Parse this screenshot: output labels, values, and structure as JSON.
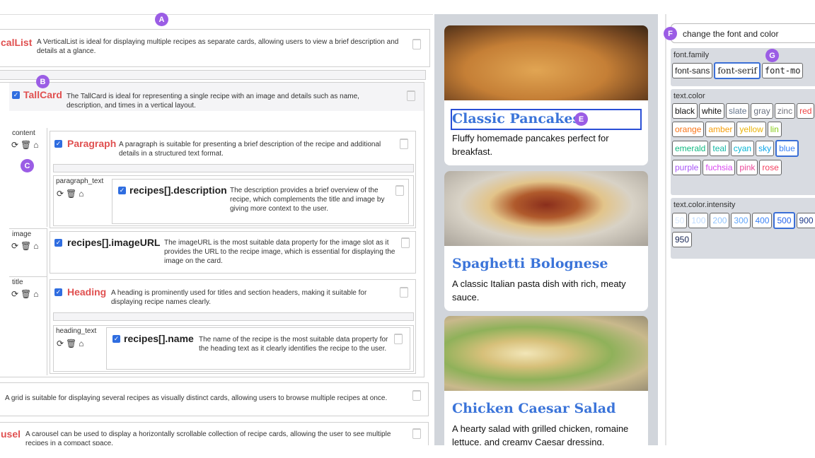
{
  "annotations": {
    "a": "A",
    "b": "B",
    "c": "C",
    "e": "E",
    "f": "F",
    "g": "G"
  },
  "left": {
    "vertical_list": {
      "title": "calList",
      "desc": "A VerticalList is ideal for displaying multiple recipes as separate cards, allowing users to view a brief description and details at a glance."
    },
    "tallcard": {
      "title": "TallCard",
      "desc": "The TallCard is ideal for representing a single recipe with an image and details such as name, description, and times in a vertical layout."
    },
    "slot_content": "content",
    "paragraph": {
      "title": "Paragraph",
      "desc": "A paragraph is suitable for presenting a brief description of the recipe and additional details in a structured text format."
    },
    "slot_paragraph_text": "paragraph_text",
    "desc_prop": {
      "title": "recipes[].description",
      "desc": "The description provides a brief overview of the recipe, which complements the title and image by giving more context to the user."
    },
    "slot_image": "image",
    "image_prop": {
      "title": "recipes[].imageURL",
      "desc": "The imageURL is the most suitable data property for the image slot as it provides the URL to the recipe image, which is essential for displaying the image on the card."
    },
    "slot_title": "title",
    "heading": {
      "title": "Heading",
      "desc": "A heading is prominently used for titles and section headers, making it suitable for displaying recipe names clearly."
    },
    "slot_heading_text": "heading_text",
    "name_prop": {
      "title": "recipes[].name",
      "desc": "The name of the recipe is the most suitable data property for the heading text as it clearly identifies the recipe to the user."
    },
    "grid": {
      "desc": "A grid is suitable for displaying several recipes as visually distinct cards, allowing users to browse multiple recipes at once."
    },
    "carousel": {
      "title": "usel",
      "desc": "A carousel can be used to display a horizontally scrollable collection of recipe cards, allowing the user to see multiple recipes in a compact space."
    },
    "icons": [
      "refresh-icon",
      "trash-icon",
      "lock-icon"
    ]
  },
  "preview": {
    "cards": [
      {
        "title": "Classic Pancakes",
        "desc": "Fluffy homemade pancakes perfect for breakfast."
      },
      {
        "title": "Spaghetti Bolognese",
        "desc": "A classic Italian pasta dish with rich, meaty sauce."
      },
      {
        "title": "Chicken Caesar Salad",
        "desc": "A hearty salad with grilled chicken, romaine lettuce, and creamy Caesar dressing."
      }
    ]
  },
  "style_panel": {
    "prompt": "change the font and color",
    "font_family": {
      "label": "font.family",
      "options": [
        "font-sans",
        "font-serif",
        "font-mo"
      ],
      "selected": "font-serif"
    },
    "text_color": {
      "label": "text.color",
      "options": [
        {
          "name": "black",
          "color": "#111111"
        },
        {
          "name": "white",
          "color": "#111111"
        },
        {
          "name": "slate",
          "color": "#64748b"
        },
        {
          "name": "gray",
          "color": "#6b7280"
        },
        {
          "name": "zinc",
          "color": "#71717a"
        },
        {
          "name": "red",
          "color": "#ef4444"
        },
        {
          "name": "orange",
          "color": "#f97316"
        },
        {
          "name": "amber",
          "color": "#f59e0b"
        },
        {
          "name": "yellow",
          "color": "#eab308"
        },
        {
          "name": "lin",
          "color": "#84cc16"
        },
        {
          "name": "emerald",
          "color": "#10b981"
        },
        {
          "name": "teal",
          "color": "#14b8a6"
        },
        {
          "name": "cyan",
          "color": "#06b6d4"
        },
        {
          "name": "sky",
          "color": "#0ea5e9"
        },
        {
          "name": "blue",
          "color": "#3b82f6"
        },
        {
          "name": "purple",
          "color": "#a855f7"
        },
        {
          "name": "fuchsia",
          "color": "#d946ef"
        },
        {
          "name": "pink",
          "color": "#ec4899"
        },
        {
          "name": "rose",
          "color": "#f43f5e"
        }
      ],
      "selected": "blue"
    },
    "intensity": {
      "label": "text.color.intensity",
      "options": [
        {
          "name": "50",
          "color": "#dbeafe"
        },
        {
          "name": "100",
          "color": "#bfdbfe"
        },
        {
          "name": "200",
          "color": "#93c5fd"
        },
        {
          "name": "300",
          "color": "#60a5fa"
        },
        {
          "name": "400",
          "color": "#3b82f6"
        },
        {
          "name": "500",
          "color": "#2563eb"
        },
        {
          "name": "900",
          "color": "#1e3a8a"
        },
        {
          "name": "950",
          "color": "#172554"
        }
      ],
      "selected": "500"
    }
  }
}
